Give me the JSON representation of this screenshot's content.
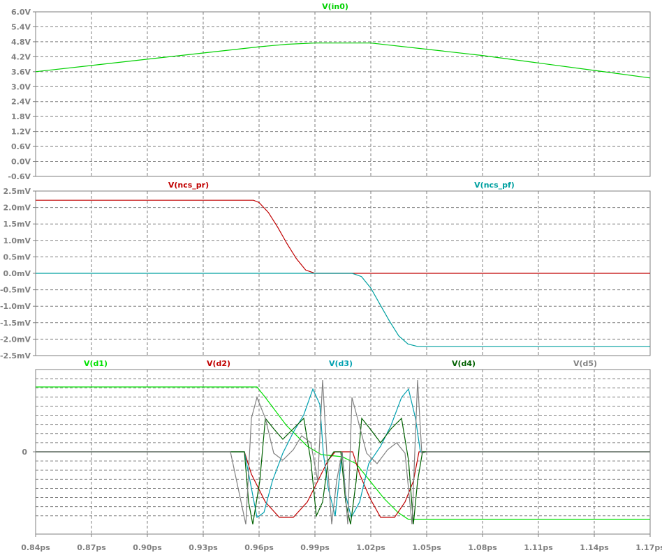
{
  "chart_data": [
    {
      "type": "line",
      "title": "",
      "xlabel": "",
      "ylabel": "",
      "xlim": [
        0.84,
        1.17
      ],
      "ylim": [
        -0.6,
        6.0
      ],
      "x_ticks": [
        "0.84ps",
        "0.87ps",
        "0.90ps",
        "0.93ps",
        "0.96ps",
        "0.99ps",
        "1.02ps",
        "1.05ps",
        "1.08ps",
        "1.11ps",
        "1.14ps",
        "1.17ps"
      ],
      "y_ticks": [
        "6.0V",
        "5.4V",
        "4.8V",
        "4.2V",
        "3.6V",
        "3.0V",
        "2.4V",
        "1.8V",
        "1.2V",
        "0.6V",
        "0.0V",
        "-0.6V"
      ],
      "grid": true,
      "series": [
        {
          "name": "V(in0)",
          "color": "#00d000",
          "x": [
            0.84,
            0.87,
            0.9,
            0.93,
            0.96,
            0.975,
            0.99,
            1.0,
            1.01,
            1.02,
            1.05,
            1.08,
            1.11,
            1.14,
            1.17
          ],
          "y": [
            3.6,
            3.85,
            4.1,
            4.35,
            4.6,
            4.7,
            4.75,
            4.75,
            4.75,
            4.75,
            4.5,
            4.25,
            3.95,
            3.65,
            3.35
          ]
        }
      ]
    },
    {
      "type": "line",
      "title": "",
      "xlabel": "",
      "ylabel": "",
      "xlim": [
        0.84,
        1.17
      ],
      "ylim": [
        -2.5,
        2.5
      ],
      "x_ticks": [
        "0.84ps",
        "0.87ps",
        "0.90ps",
        "0.93ps",
        "0.96ps",
        "0.99ps",
        "1.02ps",
        "1.05ps",
        "1.08ps",
        "1.11ps",
        "1.14ps",
        "1.17ps"
      ],
      "y_ticks": [
        "2.5mV",
        "2.0mV",
        "1.5mV",
        "1.0mV",
        "0.5mV",
        "0.0mV",
        "-0.5mV",
        "-1.0mV",
        "-1.5mV",
        "-2.0mV",
        "-2.5mV"
      ],
      "grid": true,
      "series": [
        {
          "name": "V(ncs_pr)",
          "color": "#c00000",
          "x": [
            0.84,
            0.957,
            0.96,
            0.965,
            0.97,
            0.975,
            0.98,
            0.985,
            0.99,
            1.17
          ],
          "y": [
            2.22,
            2.22,
            2.15,
            1.85,
            1.4,
            0.9,
            0.45,
            0.1,
            0.0,
            0.0
          ]
        },
        {
          "name": "V(ncs_pf)",
          "color": "#00a0a0",
          "x": [
            0.84,
            1.01,
            1.015,
            1.02,
            1.025,
            1.03,
            1.035,
            1.04,
            1.045,
            1.17
          ],
          "y": [
            0.0,
            0.0,
            -0.1,
            -0.45,
            -0.95,
            -1.45,
            -1.9,
            -2.15,
            -2.22,
            -2.22
          ]
        }
      ]
    },
    {
      "type": "line",
      "title": "",
      "xlabel": "",
      "ylabel": "",
      "xlim": [
        0.84,
        1.17
      ],
      "x_ticks": [
        "0.84ps",
        "0.87ps",
        "0.90ps",
        "0.93ps",
        "0.96ps",
        "0.99ps",
        "1.02ps",
        "1.05ps",
        "1.08ps",
        "1.11ps",
        "1.14ps",
        "1.17ps"
      ],
      "y_ticks": [
        "0"
      ],
      "grid": true,
      "series": [
        {
          "name": "V(d1)",
          "color": "#00e000"
        },
        {
          "name": "V(d2)",
          "color": "#c00000"
        },
        {
          "name": "V(d3)",
          "color": "#00a0b0"
        },
        {
          "name": "V(d4)",
          "color": "#006000"
        },
        {
          "name": "V(d5)",
          "color": "#808080"
        }
      ]
    }
  ]
}
